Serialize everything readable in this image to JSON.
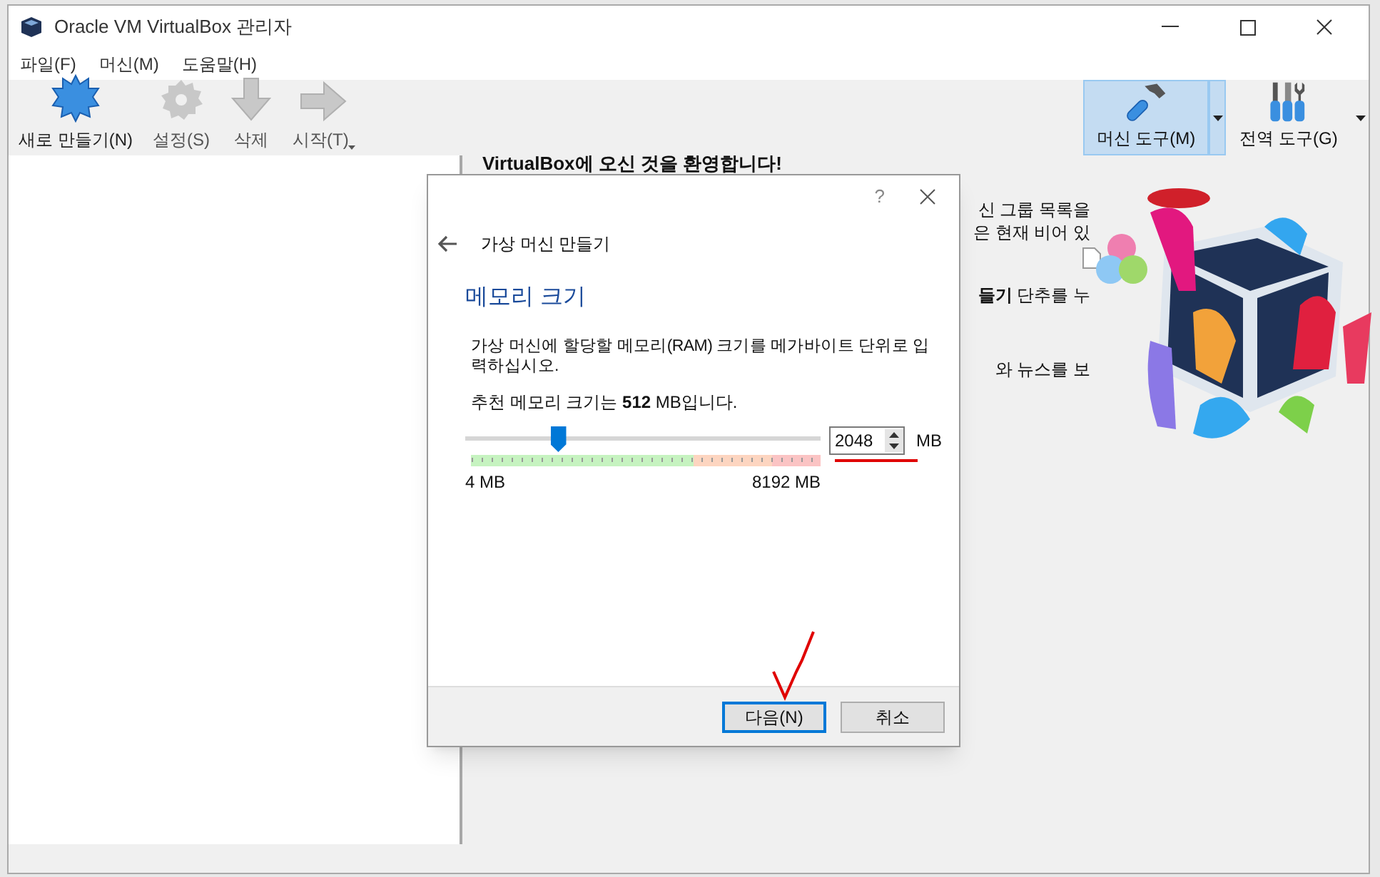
{
  "window": {
    "title": "Oracle VM VirtualBox 관리자"
  },
  "menu": [
    "파일(F)",
    "머신(M)",
    "도움말(H)"
  ],
  "toolbar": [
    {
      "kind": "new",
      "label": "새로 만들기(N)",
      "disabled": false,
      "dropdown": false
    },
    {
      "kind": "settings",
      "label": "설정(S)",
      "disabled": true,
      "dropdown": false
    },
    {
      "kind": "remove",
      "label": "삭제",
      "disabled": true,
      "dropdown": false
    },
    {
      "kind": "start",
      "label": "시작(T)",
      "disabled": true,
      "dropdown": true
    }
  ],
  "tools": [
    {
      "kind": "machine",
      "label": "머신 도구(M)",
      "selected": true
    },
    {
      "kind": "global",
      "label": "전역 도구(G)",
      "selected": false
    }
  ],
  "welcome": {
    "title": "VirtualBox에 오신 것을 환영합니다!",
    "lines": [
      "신 그룹 목록을",
      "은 현재 비어 있",
      "**들기** 단추를 누",
      "와 뉴스를 보"
    ]
  },
  "dialog": {
    "help": "?",
    "back_title": "가상 머신 만들기",
    "heading": "메모리 크기",
    "description": "가상 머신에 할당할 메모리(RAM) 크기를 메가바이트 단위로 입력하십시오.",
    "recommended": "추천 메모리 크기는 **512** MB입니다.",
    "slider": {
      "level": 0.26,
      "min_label": "4 MB",
      "max_label": "8192 MB"
    },
    "value": "2048",
    "unit": "MB",
    "buttons": [
      {
        "label": "다음(N)",
        "default": true
      },
      {
        "label": "취소",
        "default": false
      }
    ]
  }
}
